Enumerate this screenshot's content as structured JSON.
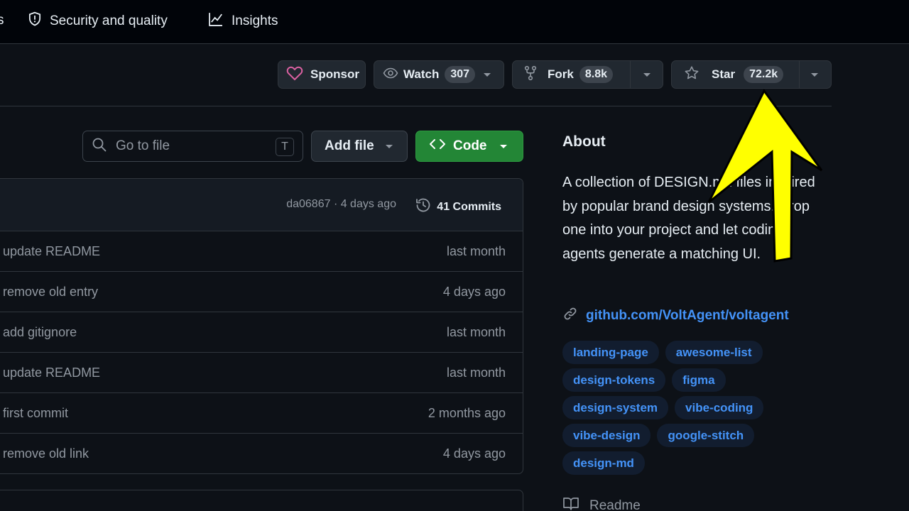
{
  "nav": {
    "partial_tab_label": "s",
    "security_label": "Security and quality",
    "insights_label": "Insights"
  },
  "actions": {
    "sponsor_label": "Sponsor",
    "watch_label": "Watch",
    "watch_count": "307",
    "fork_label": "Fork",
    "fork_count": "8.8k",
    "star_label": "Star",
    "star_count": "72.2k"
  },
  "toolbar": {
    "search_placeholder": "Go to file",
    "search_shortcut": "T",
    "add_file_label": "Add file",
    "code_label": "Code"
  },
  "files": {
    "latest_commit": "da06867 · 4 days ago",
    "commits_label": "41 Commits",
    "rows": [
      {
        "message": "update README",
        "date": "last month"
      },
      {
        "message": "remove old entry",
        "date": "4 days ago"
      },
      {
        "message": "add gitignore",
        "date": "last month"
      },
      {
        "message": "update README",
        "date": "last month"
      },
      {
        "message": "first commit",
        "date": "2 months ago"
      },
      {
        "message": "remove old link",
        "date": "4 days ago"
      }
    ]
  },
  "about": {
    "title": "About",
    "description": "A collection of DESIGN.md files inspired by popular brand design systems. Drop one into your project and let coding agents generate a matching UI.",
    "link": "github.com/VoltAgent/voltagent",
    "topics": [
      "landing-page",
      "awesome-list",
      "design-tokens",
      "figma",
      "design-system",
      "vibe-coding",
      "vibe-design",
      "google-stitch",
      "design-md"
    ],
    "readme_label": "Readme"
  },
  "colors": {
    "background": "#0d1117",
    "code_button": "#238636",
    "link_blue": "#4493f8",
    "sponsor_heart": "#db61a2",
    "annotation_arrow": "#ffff00"
  },
  "icons": [
    "shield-icon",
    "graph-icon",
    "heart-icon",
    "eye-icon",
    "fork-icon",
    "star-icon",
    "search-icon",
    "code-icon",
    "history-icon",
    "link-icon",
    "book-icon"
  ]
}
